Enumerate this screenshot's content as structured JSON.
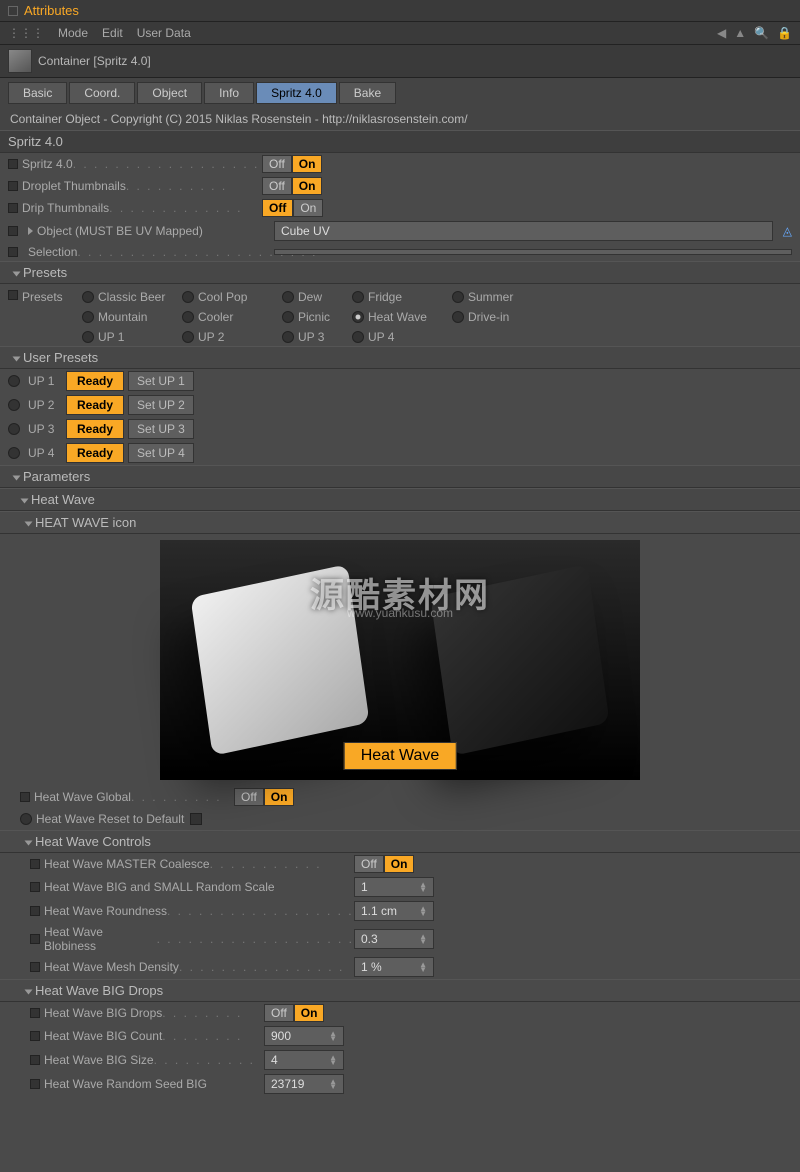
{
  "header": {
    "title": "Attributes"
  },
  "menubar": {
    "items": [
      "Mode",
      "Edit",
      "User Data"
    ]
  },
  "object": {
    "name": "Container [Spritz 4.0]"
  },
  "tabs": [
    "Basic",
    "Coord.",
    "Object",
    "Info",
    "Spritz 4.0",
    "Bake"
  ],
  "active_tab": "Spritz 4.0",
  "copyright": "Container Object - Copyright (C) 2015 Niklas Rosenstein - http://niklasrosenstein.com/",
  "main_section": "Spritz 4.0",
  "toggles": {
    "spritz": {
      "label": "Spritz 4.0",
      "off": "Off",
      "on": "On",
      "state": "on"
    },
    "droplet": {
      "label": "Droplet Thumbnails",
      "off": "Off",
      "on": "On",
      "state": "on"
    },
    "drip": {
      "label": "Drip Thumbnails",
      "off": "Off",
      "on": "On",
      "state": "off"
    }
  },
  "object_field": {
    "label": "Object (MUST BE UV Mapped)",
    "value": "Cube UV"
  },
  "selection": {
    "label": "Selection",
    "value": ""
  },
  "presets_section": "Presets",
  "presets_label": "Presets",
  "presets": [
    [
      "Classic Beer",
      "Cool Pop",
      "Dew",
      "Fridge",
      "Summer"
    ],
    [
      "Mountain",
      "Cooler",
      "Picnic",
      "Heat Wave",
      "Drive-in"
    ],
    [
      "UP 1",
      "UP 2",
      "UP 3",
      "UP 4"
    ]
  ],
  "selected_preset": "Heat Wave",
  "user_presets_section": "User Presets",
  "user_presets": [
    {
      "name": "UP 1",
      "ready": "Ready",
      "set": "Set UP 1"
    },
    {
      "name": "UP 2",
      "ready": "Ready",
      "set": "Set UP 2"
    },
    {
      "name": "UP 3",
      "ready": "Ready",
      "set": "Set UP 3"
    },
    {
      "name": "UP 4",
      "ready": "Ready",
      "set": "Set UP 4"
    }
  ],
  "parameters_section": "Parameters",
  "heat_wave_section": "Heat Wave",
  "heat_wave_icon_section": "HEAT WAVE icon",
  "preview_label": "Heat Wave",
  "watermark": "源酷素材网",
  "watermark_sub": "www.yuankusu.com",
  "heat_wave_global": {
    "label": "Heat Wave Global",
    "off": "Off",
    "on": "On",
    "state": "on"
  },
  "heat_wave_reset": {
    "label": "Heat Wave Reset to Default"
  },
  "controls_section": "Heat Wave Controls",
  "controls": {
    "coalesce": {
      "label": "Heat Wave MASTER Coalesce",
      "off": "Off",
      "on": "On",
      "state": "on"
    },
    "random_scale": {
      "label": "Heat Wave BIG and SMALL Random Scale",
      "value": "1"
    },
    "roundness": {
      "label": "Heat Wave Roundness",
      "value": "1.1 cm"
    },
    "blobiness": {
      "label": "Heat Wave Blobiness",
      "value": "0.3"
    },
    "mesh_density": {
      "label": "Heat Wave Mesh Density",
      "value": "1 %"
    }
  },
  "big_drops_section": "Heat Wave BIG Drops",
  "big_drops": {
    "drops": {
      "label": "Heat Wave BIG Drops",
      "off": "Off",
      "on": "On",
      "state": "on"
    },
    "count": {
      "label": "Heat Wave BIG Count",
      "value": "900"
    },
    "size": {
      "label": "Heat Wave BIG Size",
      "value": "4"
    },
    "seed": {
      "label": "Heat Wave Random Seed BIG",
      "value": "23719"
    }
  }
}
